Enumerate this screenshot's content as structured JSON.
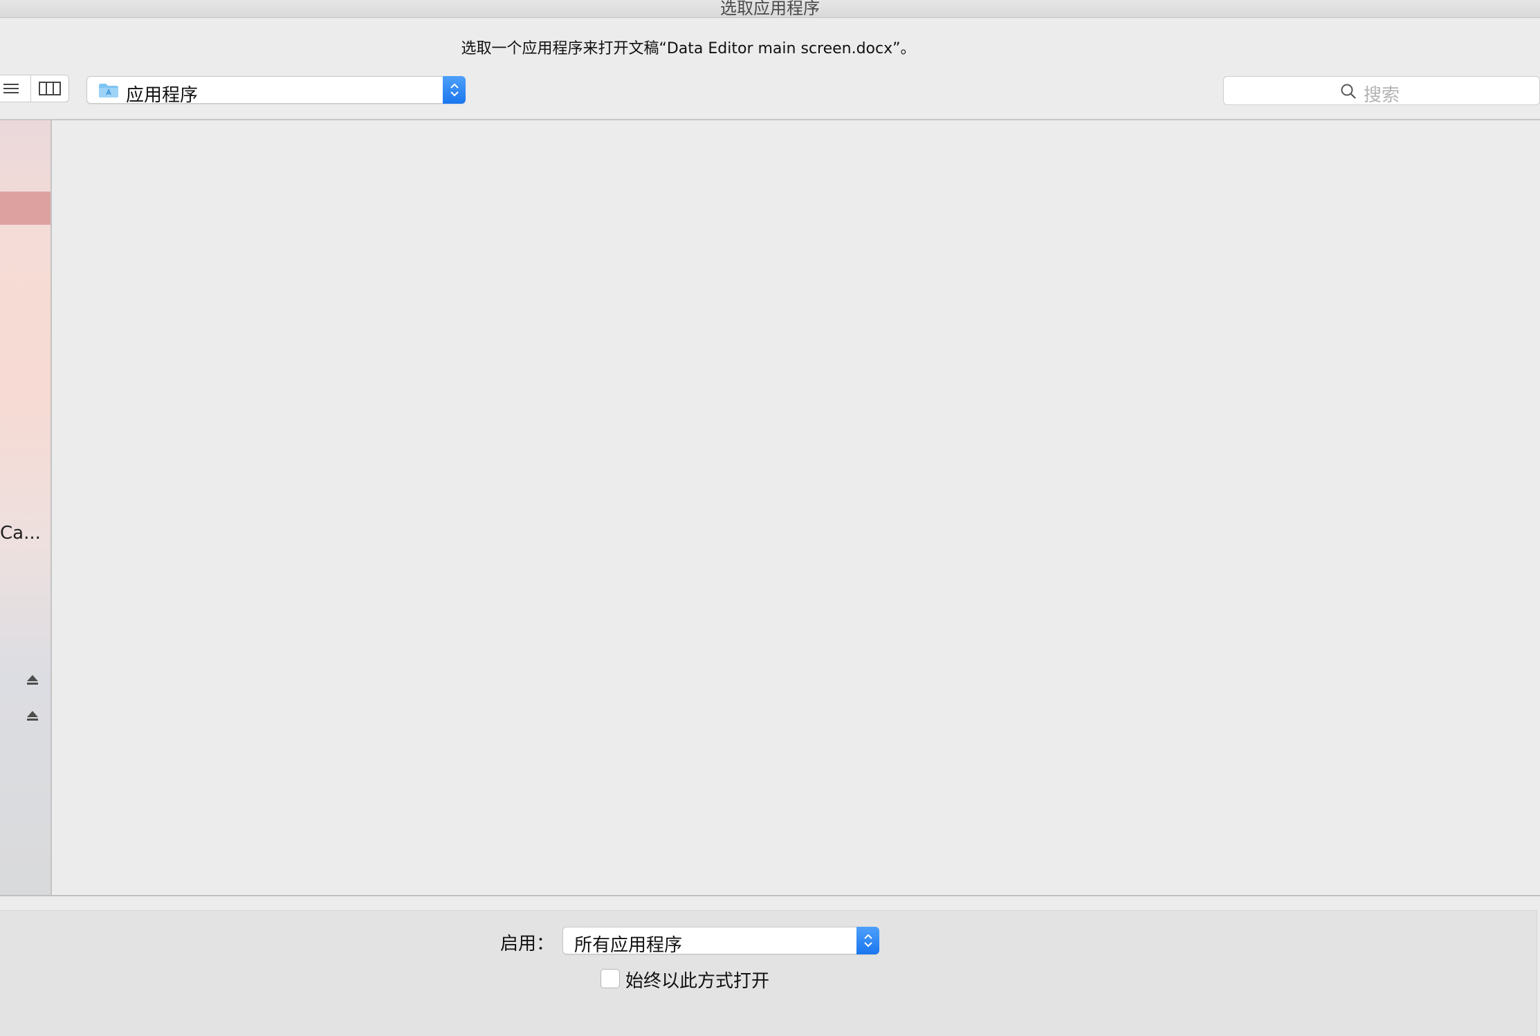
{
  "window": {
    "title": "选取应用程序",
    "prompt": "选取一个应用程序来打开文稿“Data Editor main screen.docx”。"
  },
  "toolbar": {
    "view_modes": [
      "list",
      "column"
    ],
    "location": "应用程序",
    "search_placeholder": "搜索"
  },
  "sidebar": {
    "truncated_item": "Ca..."
  },
  "footer": {
    "enable_label": "启用：",
    "enable_value": "所有应用程序",
    "always_open_label": "始终以此方式打开",
    "always_open_checked": false
  },
  "colors": {
    "accent": "#1a76ee",
    "sidebar_selection": "#dda2a0"
  }
}
